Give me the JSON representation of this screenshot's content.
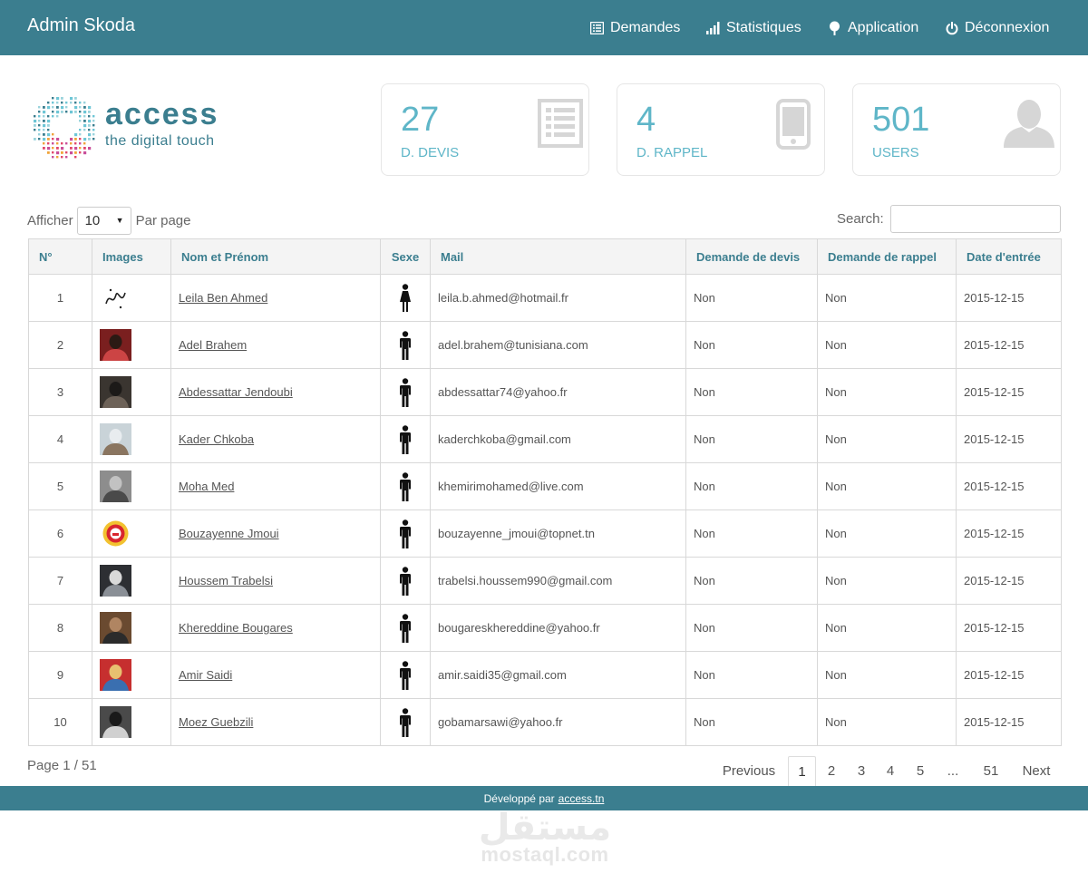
{
  "navbar": {
    "brand": "Admin Skoda",
    "items": [
      {
        "label": "Demandes",
        "icon": "list-icon"
      },
      {
        "label": "Statistiques",
        "icon": "bar-chart-icon"
      },
      {
        "label": "Application",
        "icon": "tree-icon"
      },
      {
        "label": "Déconnexion",
        "icon": "power-icon"
      }
    ]
  },
  "logo": {
    "word": "access",
    "tagline": "the digital touch"
  },
  "stats": [
    {
      "value": "27",
      "label": "D. DEVIS",
      "icon": "list-icon"
    },
    {
      "value": "4",
      "label": "D. RAPPEL",
      "icon": "mobile-phone-icon"
    },
    {
      "value": "501",
      "label": "USERS",
      "icon": "user-icon"
    }
  ],
  "controls": {
    "afficher_label": "Afficher",
    "per_page_value": "10",
    "par_page_label": "Par page",
    "search_label": "Search:",
    "search_value": ""
  },
  "table": {
    "headers": [
      "N°",
      "Images",
      "Nom et Prénom",
      "Sexe",
      "Mail",
      "Demande de devis",
      "Demande de rappel",
      "Date d'entrée"
    ],
    "rows": [
      {
        "num": "1",
        "name": "Leila Ben Ahmed",
        "sexe": "female",
        "mail": "leila.b.ahmed@hotmail.fr",
        "devis": "Non",
        "rappel": "Non",
        "date": "2015-12-15"
      },
      {
        "num": "2",
        "name": "Adel Brahem",
        "sexe": "male",
        "mail": "adel.brahem@tunisiana.com",
        "devis": "Non",
        "rappel": "Non",
        "date": "2015-12-15"
      },
      {
        "num": "3",
        "name": "Abdessattar Jendoubi",
        "sexe": "male",
        "mail": "abdessattar74@yahoo.fr",
        "devis": "Non",
        "rappel": "Non",
        "date": "2015-12-15"
      },
      {
        "num": "4",
        "name": "Kader Chkoba",
        "sexe": "male",
        "mail": "kaderchkoba@gmail.com",
        "devis": "Non",
        "rappel": "Non",
        "date": "2015-12-15"
      },
      {
        "num": "5",
        "name": "Moha Med",
        "sexe": "male",
        "mail": "khemirimohamed@live.com",
        "devis": "Non",
        "rappel": "Non",
        "date": "2015-12-15"
      },
      {
        "num": "6",
        "name": "Bouzayenne Jmoui",
        "sexe": "male",
        "mail": "bouzayenne_jmoui@topnet.tn",
        "devis": "Non",
        "rappel": "Non",
        "date": "2015-12-15"
      },
      {
        "num": "7",
        "name": "Houssem Trabelsi",
        "sexe": "male",
        "mail": "trabelsi.houssem990@gmail.com",
        "devis": "Non",
        "rappel": "Non",
        "date": "2015-12-15"
      },
      {
        "num": "8",
        "name": "Khereddine Bougares",
        "sexe": "male",
        "mail": "bougareskhereddine@yahoo.fr",
        "devis": "Non",
        "rappel": "Non",
        "date": "2015-12-15"
      },
      {
        "num": "9",
        "name": "Amir Saidi",
        "sexe": "male",
        "mail": "amir.saidi35@gmail.com",
        "devis": "Non",
        "rappel": "Non",
        "date": "2015-12-15"
      },
      {
        "num": "10",
        "name": "Moez Guebzili",
        "sexe": "male",
        "mail": "gobamarsawi@yahoo.fr",
        "devis": "Non",
        "rappel": "Non",
        "date": "2015-12-15"
      }
    ]
  },
  "pagination": {
    "page_info": "Page 1 / 51",
    "previous": "Previous",
    "pages": [
      "1",
      "2",
      "3",
      "4",
      "5",
      "...",
      "51"
    ],
    "active": "1",
    "next": "Next"
  },
  "footer": {
    "text": "Développé par",
    "link": "access.tn"
  },
  "watermark": {
    "arabic": "مستقل",
    "latin": "mostaql.com"
  },
  "colors": {
    "primary": "#3b7e8f",
    "accent": "#5fb6c8",
    "icon_gray": "#d6d6d6"
  }
}
